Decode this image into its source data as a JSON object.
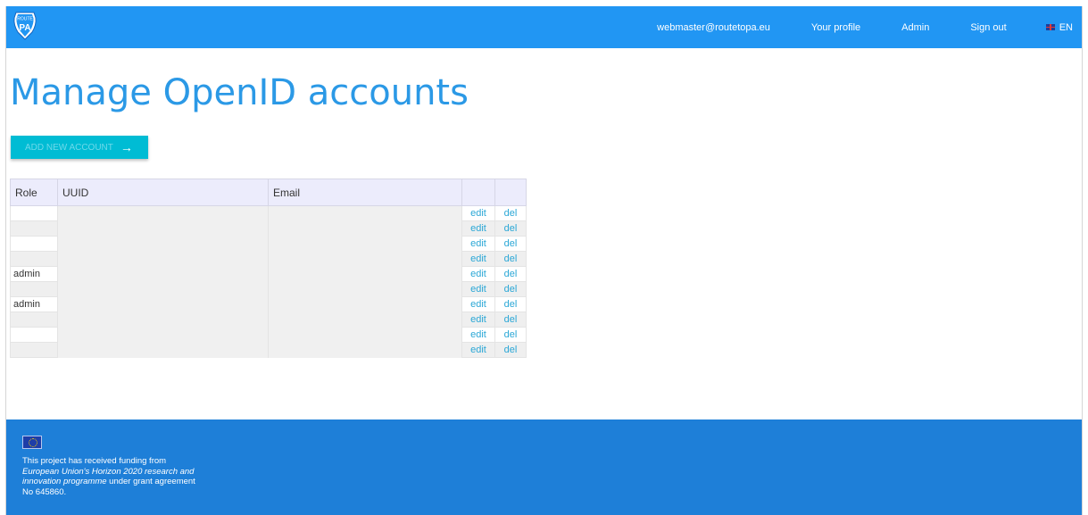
{
  "nav": {
    "email": "webmaster@routetopa.eu",
    "profile": "Your profile",
    "admin": "Admin",
    "signout": "Sign out",
    "language": "EN"
  },
  "logo": {
    "line1": "ROUTE",
    "line2": "PA"
  },
  "page": {
    "title": "Manage OpenID accounts",
    "add_button": "ADD NEW ACCOUNT"
  },
  "table": {
    "headers": {
      "role": "Role",
      "uuid": "UUID",
      "email": "Email",
      "edit": "",
      "del": ""
    },
    "rows": [
      {
        "role": "",
        "edit": "edit",
        "del": "del"
      },
      {
        "role": "",
        "edit": "edit",
        "del": "del"
      },
      {
        "role": "",
        "edit": "edit",
        "del": "del"
      },
      {
        "role": "",
        "edit": "edit",
        "del": "del"
      },
      {
        "role": "admin",
        "edit": "edit",
        "del": "del"
      },
      {
        "role": "",
        "edit": "edit",
        "del": "del"
      },
      {
        "role": "admin",
        "edit": "edit",
        "del": "del"
      },
      {
        "role": "",
        "edit": "edit",
        "del": "del"
      },
      {
        "role": "",
        "edit": "edit",
        "del": "del"
      },
      {
        "role": "",
        "edit": "edit",
        "del": "del"
      }
    ]
  },
  "footer": {
    "line1": "This project has received funding from",
    "program_name": "European Union's Horizon 2020 research and innovation programme",
    "line3": "under grant agreement",
    "line4": "No 645860."
  },
  "colors": {
    "header_bg": "#2196f3",
    "title": "#2b99e6",
    "button_bg": "#00bcd4",
    "footer_bg": "#1e7fd8",
    "link": "#2aa7d6"
  },
  "icons": [
    "routetopa-logo-icon",
    "uk-flag-icon",
    "arrow-right-icon",
    "eu-flag-icon"
  ]
}
